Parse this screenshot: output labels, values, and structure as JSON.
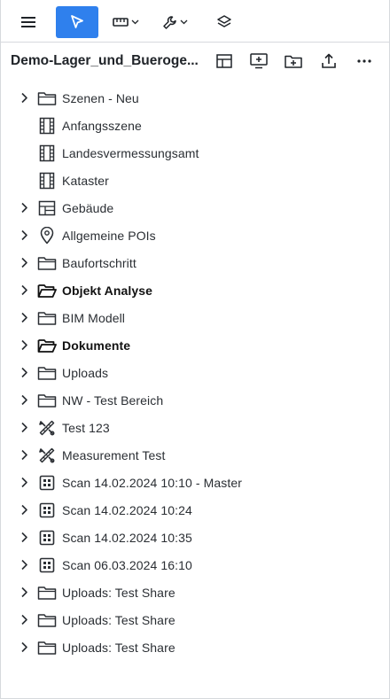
{
  "toolbar": {
    "menu_icon": "hamburger-menu-icon",
    "select_icon": "cursor-arrow-icon",
    "measure_icon": "ruler-icon",
    "tools_icon": "wrench-icon",
    "layers_icon": "layers-icon",
    "accent_color": "#2f80ed"
  },
  "header": {
    "project_title": "Demo-Lager_und_Bueroge...",
    "actions": [
      "layout-icon",
      "add-screen-icon",
      "new-folder-icon",
      "upload-icon",
      "more-options-icon"
    ]
  },
  "tree": {
    "items": [
      {
        "label": "Szenen - Neu",
        "icon": "folder-icon",
        "expandable": true,
        "bold": false
      },
      {
        "label": "Anfangsszene",
        "icon": "film-strip-icon",
        "expandable": false,
        "bold": false
      },
      {
        "label": "Landesvermessungsamt",
        "icon": "film-strip-icon",
        "expandable": false,
        "bold": false
      },
      {
        "label": "Kataster",
        "icon": "film-strip-icon",
        "expandable": false,
        "bold": false
      },
      {
        "label": "Gebäude",
        "icon": "building-layout-icon",
        "expandable": true,
        "bold": false
      },
      {
        "label": "Allgemeine POIs",
        "icon": "map-pin-icon",
        "expandable": true,
        "bold": false
      },
      {
        "label": "Baufortschritt",
        "icon": "folder-icon",
        "expandable": true,
        "bold": false
      },
      {
        "label": "Objekt Analyse",
        "icon": "folder-open-icon",
        "expandable": true,
        "bold": true
      },
      {
        "label": "BIM Modell",
        "icon": "folder-icon",
        "expandable": true,
        "bold": false
      },
      {
        "label": "Dokumente",
        "icon": "folder-open-icon",
        "expandable": true,
        "bold": true
      },
      {
        "label": "Uploads",
        "icon": "folder-icon",
        "expandable": true,
        "bold": false
      },
      {
        "label": "NW - Test Bereich",
        "icon": "folder-icon",
        "expandable": true,
        "bold": false
      },
      {
        "label": "Test 123",
        "icon": "measure-tools-icon",
        "expandable": true,
        "bold": false
      },
      {
        "label": "Measurement Test",
        "icon": "measure-tools-icon",
        "expandable": true,
        "bold": false
      },
      {
        "label": "Scan 14.02.2024 10:10 - Master",
        "icon": "scan-grid-icon",
        "expandable": true,
        "bold": false
      },
      {
        "label": "Scan 14.02.2024 10:24",
        "icon": "scan-grid-icon",
        "expandable": true,
        "bold": false
      },
      {
        "label": "Scan 14.02.2024 10:35",
        "icon": "scan-grid-icon",
        "expandable": true,
        "bold": false
      },
      {
        "label": "Scan 06.03.2024 16:10",
        "icon": "scan-grid-icon",
        "expandable": true,
        "bold": false
      },
      {
        "label": "Uploads: Test Share",
        "icon": "folder-icon",
        "expandable": true,
        "bold": false
      },
      {
        "label": "Uploads: Test Share",
        "icon": "folder-icon",
        "expandable": true,
        "bold": false
      },
      {
        "label": "Uploads: Test Share",
        "icon": "folder-icon",
        "expandable": true,
        "bold": false
      }
    ]
  }
}
